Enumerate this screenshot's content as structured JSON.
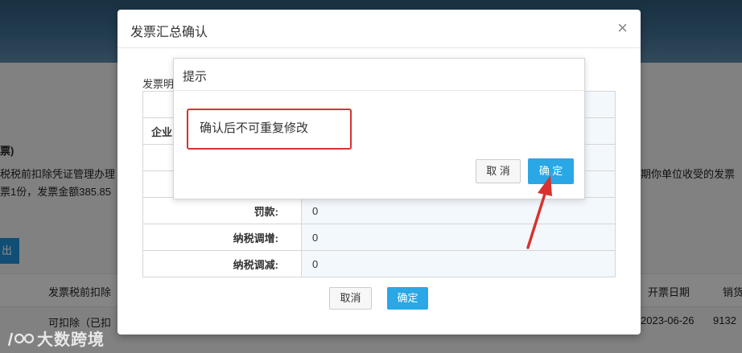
{
  "background": {
    "paren_fragment": "票)",
    "line1_left": "税税前扣除凭证管理办理",
    "line1_right": "期你单位收受的发票",
    "line2_left": "票1份，发票金额385.85",
    "export_button": "出",
    "table_headers": [
      "发票税前扣除",
      "开票日期",
      "销货"
    ],
    "row_cells": [
      "可扣除（已扣",
      "2023-06-26",
      "9132"
    ]
  },
  "modal": {
    "title": "发票汇总确认",
    "close_symbol": "×",
    "section_label": "发票明",
    "row_label_fragment": "企业",
    "rows": [
      {
        "label": "罚款:",
        "value": "0"
      },
      {
        "label": "纳税调增:",
        "value": "0"
      },
      {
        "label": "纳税调减:",
        "value": "0"
      }
    ],
    "cancel_label": "取消",
    "ok_label": "确定"
  },
  "prompt": {
    "title": "提示",
    "message": "确认后不可重复修改",
    "cancel_label": "取 消",
    "ok_label": "确 定"
  },
  "watermark": {
    "text": "大数跨境"
  },
  "colors": {
    "primary": "#2aa7e5",
    "highlight": "#d8322e"
  }
}
